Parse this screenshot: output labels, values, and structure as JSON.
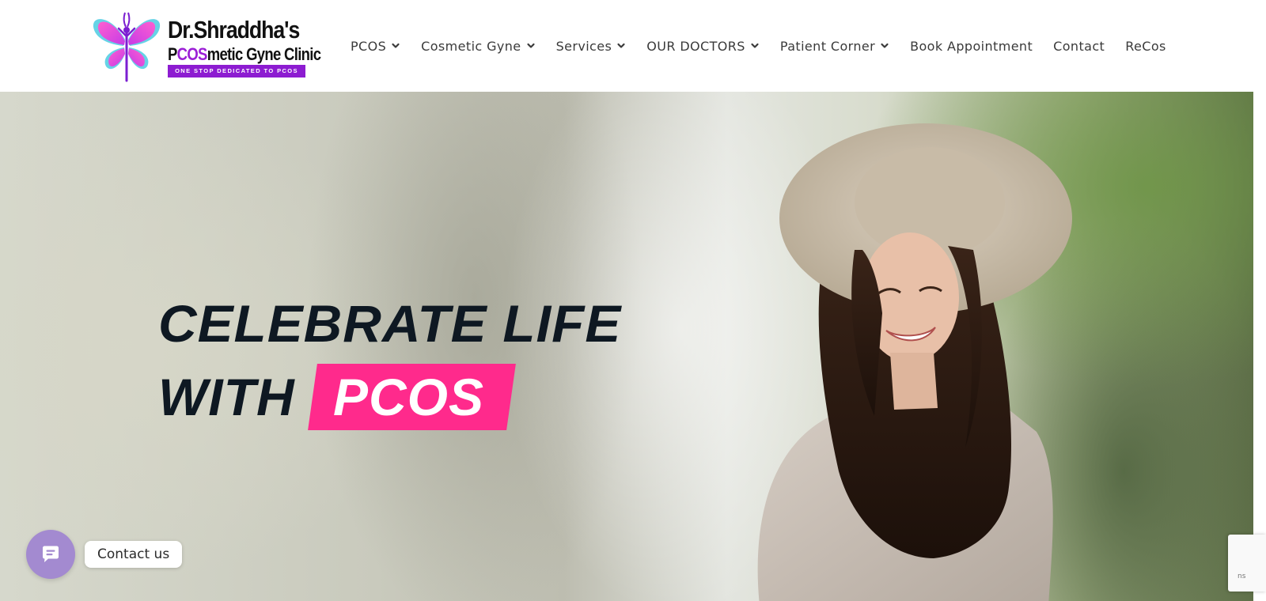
{
  "logo": {
    "name": "Dr.Shraddha's",
    "sub_prefix": "P",
    "sub_highlight": "COS",
    "sub_suffix": "metic Gyne Clinic",
    "tagline": "ONE STOP DEDICATED TO PCOS"
  },
  "nav": {
    "items": [
      {
        "label": "PCOS",
        "has_dropdown": true
      },
      {
        "label": "Cosmetic Gyne",
        "has_dropdown": true
      },
      {
        "label": "Services",
        "has_dropdown": true
      },
      {
        "label": "OUR DOCTORS",
        "has_dropdown": true
      },
      {
        "label": "Patient Corner",
        "has_dropdown": true
      },
      {
        "label": "Book Appointment",
        "has_dropdown": false
      },
      {
        "label": "Contact",
        "has_dropdown": false
      },
      {
        "label": "ReCos",
        "has_dropdown": false
      }
    ]
  },
  "hero": {
    "line1": "CELEBRATE LIFE",
    "line2_prefix": "WITH",
    "line2_highlight": "PCOS"
  },
  "contact_widget": {
    "label": "Contact us",
    "icon": "chat-icon"
  },
  "recaptcha": {
    "text": "ns"
  },
  "colors": {
    "accent_pink": "#ff2a8c",
    "brand_purple": "#8d1cd1",
    "widget_purple": "#a38ad0",
    "headline_dark": "#0e1822"
  }
}
